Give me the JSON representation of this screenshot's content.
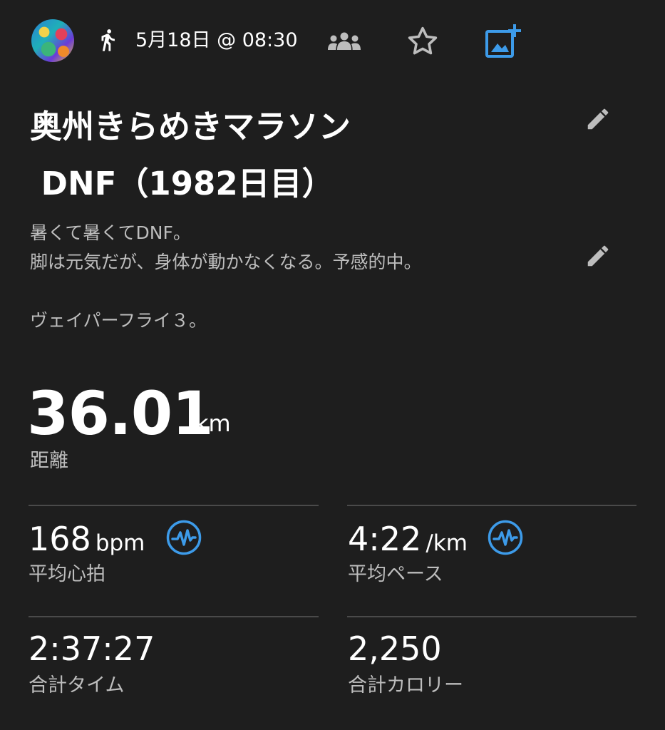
{
  "header": {
    "date_time": "5月18日 @ 08:30",
    "icons": {
      "activity": "run-icon",
      "group": "group-icon",
      "favorite": "star-icon",
      "add_photo": "add-photo-icon",
      "accent_color": "#3d9be9"
    }
  },
  "activity": {
    "title_line1": "奥州きらめきマラソン",
    "title_line2": " DNF（1982日目）",
    "description_lines": [
      "暑くて暑くてDNF。",
      "脚は元気だが、身体が動かなくなる。予感的中。",
      "",
      "ヴェイパーフライ３。"
    ]
  },
  "distance": {
    "value": "36.01",
    "unit": "km",
    "label": "距離"
  },
  "stats": {
    "avg_heart_rate": {
      "value": "168",
      "unit": "bpm",
      "label": "平均心拍"
    },
    "avg_pace": {
      "value": "4:22",
      "unit": "/km",
      "label": "平均ペース"
    },
    "total_time": {
      "value": "2:37:27",
      "label": "合計タイム"
    },
    "total_calories": {
      "value": "2,250",
      "label": "合計カロリー"
    }
  }
}
